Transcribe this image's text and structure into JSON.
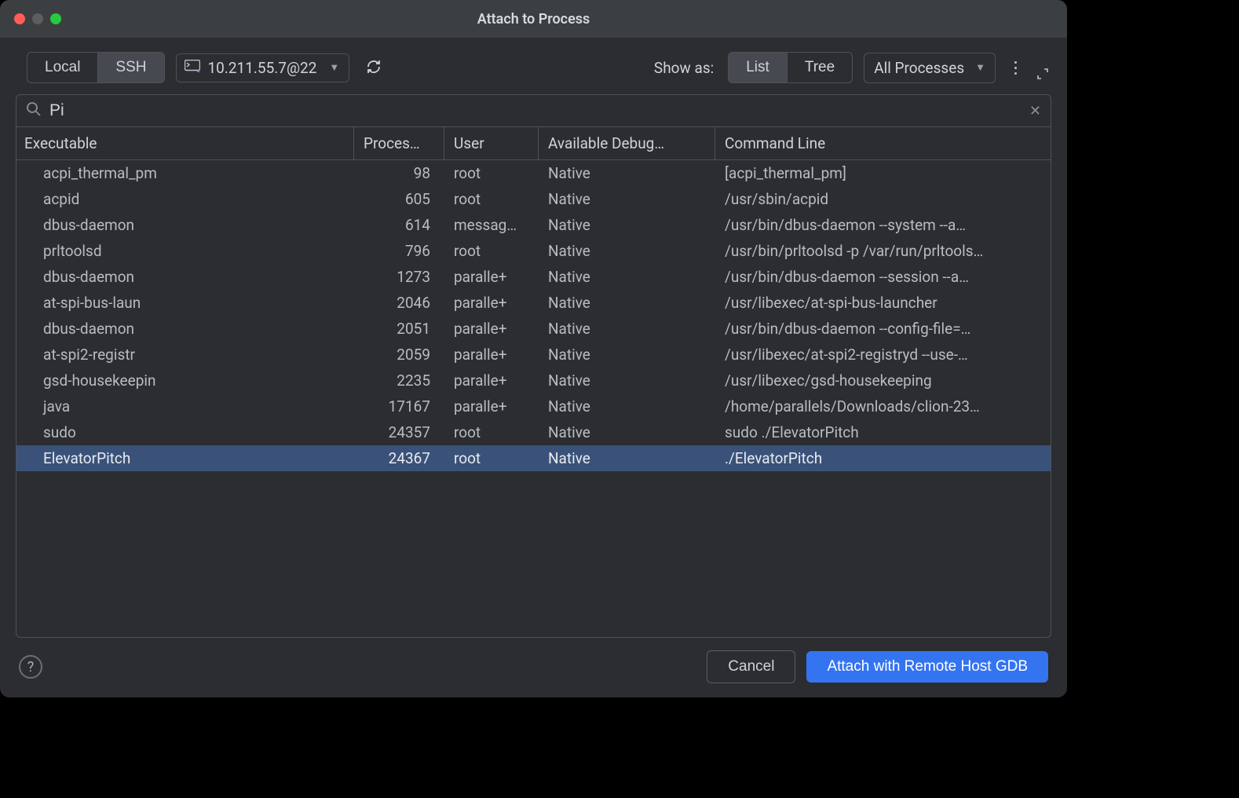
{
  "window": {
    "title": "Attach to Process"
  },
  "toolbar": {
    "connection": {
      "local": "Local",
      "ssh": "SSH",
      "active": "ssh"
    },
    "host": "10.211.55.7@22",
    "show_as_label": "Show as:",
    "view": {
      "list": "List",
      "tree": "Tree",
      "active": "list"
    },
    "filter": "All Processes"
  },
  "search": {
    "value": "Pi"
  },
  "table": {
    "columns": {
      "executable": "Executable",
      "process": "Proces…",
      "user": "User",
      "debug": "Available Debug…",
      "cmd": "Command Line"
    },
    "rows": [
      {
        "exe": "acpi_thermal_pm",
        "pid": "98",
        "user": "root",
        "debug": "Native",
        "cmd": "[acpi_thermal_pm]",
        "selected": false
      },
      {
        "exe": "acpid",
        "pid": "605",
        "user": "root",
        "debug": "Native",
        "cmd": "/usr/sbin/acpid",
        "selected": false
      },
      {
        "exe": "dbus-daemon",
        "pid": "614",
        "user": "messag…",
        "debug": "Native",
        "cmd": "/usr/bin/dbus-daemon --system --a…",
        "selected": false
      },
      {
        "exe": "prltoolsd",
        "pid": "796",
        "user": "root",
        "debug": "Native",
        "cmd": "/usr/bin/prltoolsd -p /var/run/prltools…",
        "selected": false
      },
      {
        "exe": "dbus-daemon",
        "pid": "1273",
        "user": "paralle+",
        "debug": "Native",
        "cmd": "/usr/bin/dbus-daemon --session --a…",
        "selected": false
      },
      {
        "exe": "at-spi-bus-laun",
        "pid": "2046",
        "user": "paralle+",
        "debug": "Native",
        "cmd": "/usr/libexec/at-spi-bus-launcher",
        "selected": false
      },
      {
        "exe": "dbus-daemon",
        "pid": "2051",
        "user": "paralle+",
        "debug": "Native",
        "cmd": "/usr/bin/dbus-daemon --config-file=…",
        "selected": false
      },
      {
        "exe": "at-spi2-registr",
        "pid": "2059",
        "user": "paralle+",
        "debug": "Native",
        "cmd": "/usr/libexec/at-spi2-registryd --use-…",
        "selected": false
      },
      {
        "exe": "gsd-housekeepin",
        "pid": "2235",
        "user": "paralle+",
        "debug": "Native",
        "cmd": "/usr/libexec/gsd-housekeeping",
        "selected": false
      },
      {
        "exe": "java",
        "pid": "17167",
        "user": "paralle+",
        "debug": "Native",
        "cmd": "/home/parallels/Downloads/clion-23…",
        "selected": false
      },
      {
        "exe": "sudo",
        "pid": "24357",
        "user": "root",
        "debug": "Native",
        "cmd": "sudo ./ElevatorPitch",
        "selected": false
      },
      {
        "exe": "ElevatorPitch",
        "pid": "24367",
        "user": "root",
        "debug": "Native",
        "cmd": "./ElevatorPitch",
        "selected": true
      }
    ]
  },
  "footer": {
    "cancel": "Cancel",
    "attach": "Attach with Remote Host GDB"
  }
}
